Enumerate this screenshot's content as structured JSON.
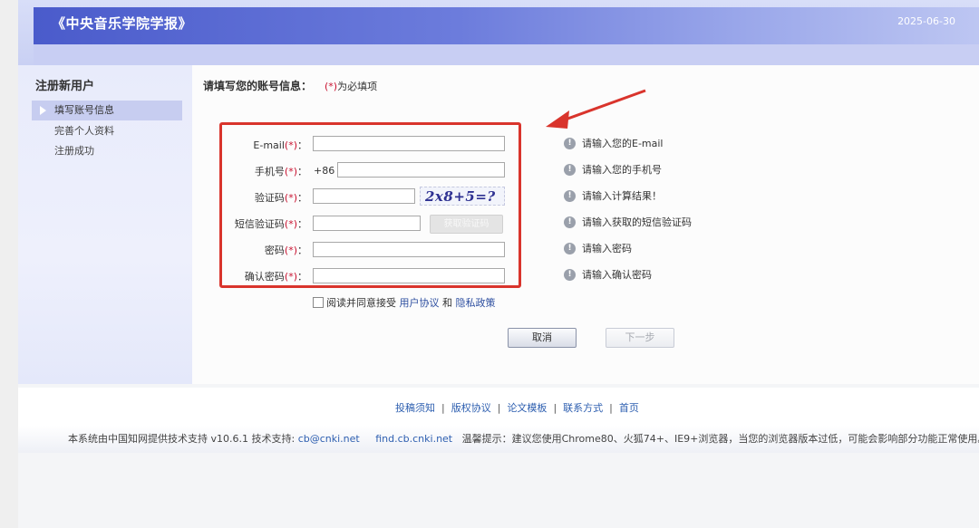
{
  "header": {
    "title": "《中央音乐学院学报》",
    "date": "2025-06-30"
  },
  "sidebar": {
    "title": "注册新用户",
    "items": [
      {
        "label": "填写账号信息",
        "active": true
      },
      {
        "label": "完善个人资料",
        "active": false
      },
      {
        "label": "注册成功",
        "active": false
      }
    ]
  },
  "main": {
    "heading": "请填写您的账号信息：",
    "required_note": {
      "star": "(*)",
      "text": "为必填项"
    }
  },
  "form": {
    "fields": [
      {
        "label": "E-mail",
        "star": "(*)",
        "colon": "：",
        "value": ""
      },
      {
        "label": "手机号",
        "star": "(*)",
        "colon": "：",
        "prefix": "+86",
        "value": ""
      },
      {
        "label": "验证码",
        "star": "(*)",
        "colon": "：",
        "value": ""
      },
      {
        "label": "短信验证码",
        "star": "(*)",
        "colon": "：",
        "value": ""
      },
      {
        "label": "密码",
        "star": "(*)",
        "colon": "：",
        "value": ""
      },
      {
        "label": "确认密码",
        "star": "(*)",
        "colon": "：",
        "value": ""
      }
    ],
    "captcha_text": "2x8+5=?",
    "sms_button": "获取验证码",
    "hints": [
      "请输入您的E-mail",
      "请输入您的手机号",
      "请输入计算结果！",
      "请输入获取的短信验证码",
      "请输入密码",
      "请输入确认密码"
    ],
    "agreement": {
      "checked": false,
      "prefix": "阅读并同意接受",
      "user_agreement": "用户协议",
      "and": "和",
      "privacy_policy": "隐私政策"
    },
    "cancel_label": "取消",
    "next_label": "下一步"
  },
  "footer": {
    "links": [
      "投稿须知",
      "版权协议",
      "论文模板",
      "联系方式",
      "首页"
    ],
    "separator": "|",
    "info_prefix": "本系统由中国知网提供技术支持 v10.6.1 技术支持:",
    "support_email": "cb@cnki.net",
    "support_site": "find.cb.cnki.net",
    "tip": "温馨提示：建议您使用Chrome80、火狐74+、IE9+浏览器，当您的浏览器版本过低，可能会影响部分功能正常使用。"
  },
  "colors": {
    "header_band": "#4a5bcb",
    "annotation_red": "#d9342c",
    "link_blue": "#2e5fb0"
  },
  "annotation": "red-arrow-pointing-to-form"
}
